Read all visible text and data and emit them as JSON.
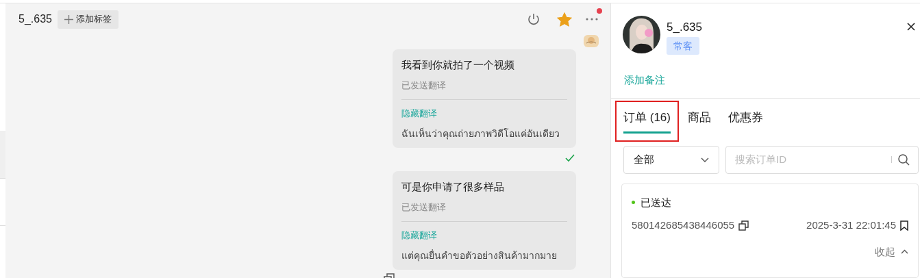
{
  "chat": {
    "title": "5_.635",
    "add_tag": "添加标签",
    "messages": [
      {
        "text": "我看到你就拍了一个视频",
        "status": "已发送翻译",
        "toggle": "隐藏翻译",
        "translation": "ฉันเห็นว่าคุณถ่ายภาพวิดีโอแค่อันเดียว",
        "read": true
      },
      {
        "text": "可是你申请了很多样品",
        "status": "已发送翻译",
        "toggle": "隐藏翻译",
        "translation": "แต่คุณยื่นคำขอตัวอย่างสินค้ามากมาย",
        "read": false
      }
    ],
    "menu_badge": true,
    "starred": true
  },
  "profile": {
    "name": "5_.635",
    "tag": "常客",
    "add_note": "添加备注"
  },
  "tabs": [
    {
      "label": "订单 (16)",
      "selected": true,
      "highlighted": true
    },
    {
      "label": "商品",
      "selected": false,
      "highlighted": false
    },
    {
      "label": "优惠券",
      "selected": false,
      "highlighted": false
    }
  ],
  "filter": {
    "value": "全部"
  },
  "search": {
    "placeholder": "搜索订单ID"
  },
  "order": {
    "status": "已送达",
    "color": "#52c41a",
    "id": "580142685438446055",
    "time": "2025-3-31 22:01:45",
    "collapse": "收起"
  }
}
